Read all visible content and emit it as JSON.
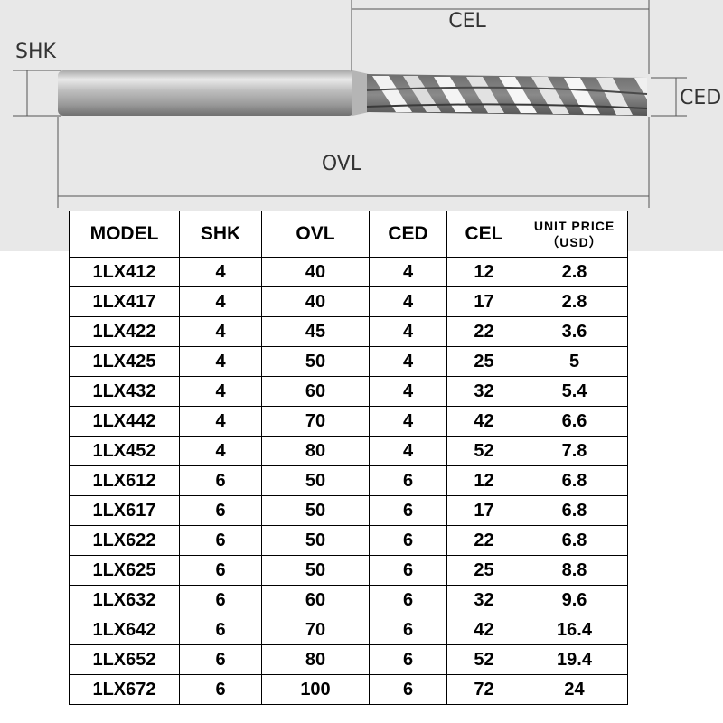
{
  "diagram": {
    "labels": {
      "cel": "CEL",
      "shk": "SHK",
      "ced": "CED",
      "ovl": "OVL"
    }
  },
  "table": {
    "headers": [
      "MODEL",
      "SHK",
      "OVL",
      "CED",
      "CEL"
    ],
    "price_header_line1": "UNIT PRICE",
    "price_header_line2": "（USD）",
    "rows": [
      [
        "1LX412",
        "4",
        "40",
        "4",
        "12",
        "2.8"
      ],
      [
        "1LX417",
        "4",
        "40",
        "4",
        "17",
        "2.8"
      ],
      [
        "1LX422",
        "4",
        "45",
        "4",
        "22",
        "3.6"
      ],
      [
        "1LX425",
        "4",
        "50",
        "4",
        "25",
        "5"
      ],
      [
        "1LX432",
        "4",
        "60",
        "4",
        "32",
        "5.4"
      ],
      [
        "1LX442",
        "4",
        "70",
        "4",
        "42",
        "6.6"
      ],
      [
        "1LX452",
        "4",
        "80",
        "4",
        "52",
        "7.8"
      ],
      [
        "1LX612",
        "6",
        "50",
        "6",
        "12",
        "6.8"
      ],
      [
        "1LX617",
        "6",
        "50",
        "6",
        "17",
        "6.8"
      ],
      [
        "1LX622",
        "6",
        "50",
        "6",
        "22",
        "6.8"
      ],
      [
        "1LX625",
        "6",
        "50",
        "6",
        "25",
        "8.8"
      ],
      [
        "1LX632",
        "6",
        "60",
        "6",
        "32",
        "9.6"
      ],
      [
        "1LX642",
        "6",
        "70",
        "6",
        "42",
        "16.4"
      ],
      [
        "1LX652",
        "6",
        "80",
        "6",
        "52",
        "19.4"
      ],
      [
        "1LX672",
        "6",
        "100",
        "6",
        "72",
        "24"
      ]
    ]
  }
}
